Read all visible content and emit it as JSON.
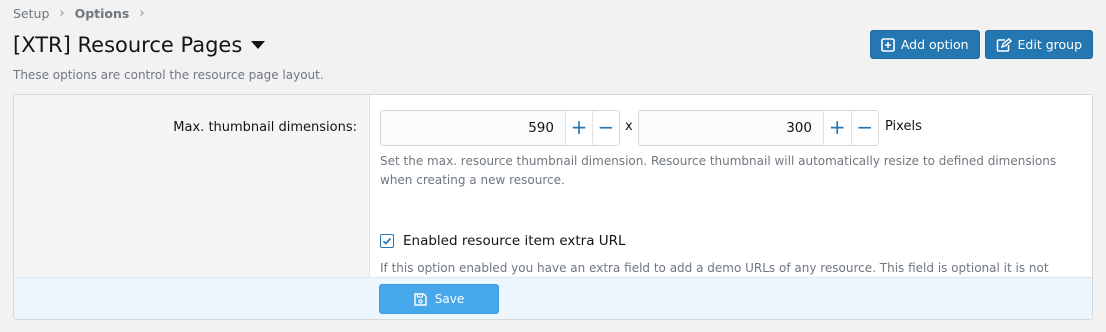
{
  "breadcrumb": {
    "items": [
      "Setup",
      "Options"
    ],
    "separator": "›"
  },
  "header": {
    "title": "[XTR] Resource Pages",
    "description": "These options are control the resource page layout.",
    "add_option_label": "Add option",
    "edit_group_label": "Edit group"
  },
  "options": {
    "thumbnail": {
      "label": "Max. thumbnail dimensions:",
      "width_value": "590",
      "height_value": "300",
      "separator": "x",
      "unit": "Pixels",
      "plus": "+",
      "minus": "−",
      "hint": "Set the max. resource thumbnail dimension. Resource thumbnail will automatically resize to defined dimensions when creating a new resource."
    },
    "extra_url": {
      "label": "Enabled resource item extra URL",
      "checked": true,
      "hint": "If this option enabled you have an extra field to add a demo URLs of any resource. This field is optional it is not required."
    }
  },
  "footer": {
    "save_label": "Save"
  },
  "colors": {
    "primary": "#2577b1",
    "save": "#47a7eb",
    "footer_bg": "#edf6fd"
  },
  "icons": {
    "add_option": "plus-square-icon",
    "edit_group": "edit-icon",
    "save": "save-icon",
    "dropdown": "caret-down-icon"
  }
}
